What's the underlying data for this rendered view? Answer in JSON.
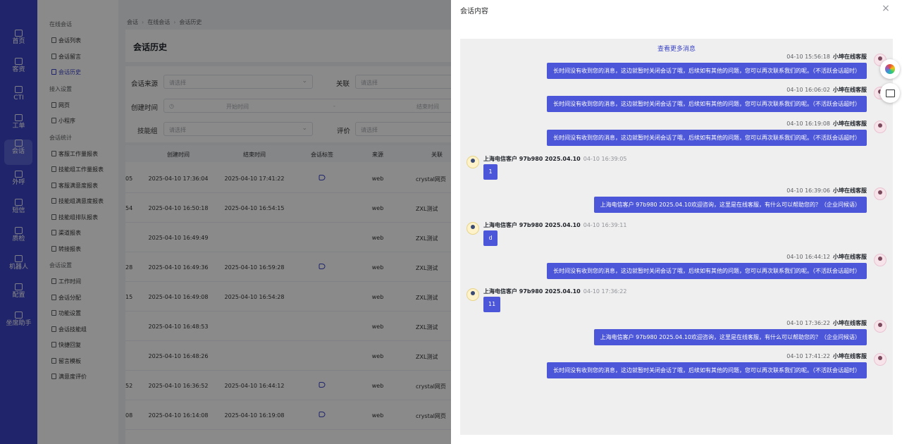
{
  "nav": {
    "items": [
      {
        "label": "首页",
        "icon": "home-icon"
      },
      {
        "label": "客资",
        "icon": "user-icon"
      },
      {
        "label": "CTI",
        "icon": "cti-icon"
      },
      {
        "label": "工单",
        "icon": "ticket-icon"
      },
      {
        "label": "会话",
        "icon": "chat-icon",
        "active": true
      },
      {
        "label": "外呼",
        "icon": "phone-icon"
      },
      {
        "label": "短信",
        "icon": "sms-icon"
      },
      {
        "label": "质检",
        "icon": "qc-icon"
      },
      {
        "label": "机器人",
        "icon": "robot-icon"
      },
      {
        "label": "配置",
        "icon": "settings-icon"
      },
      {
        "label": "坐席助手",
        "icon": "assistant-icon"
      }
    ]
  },
  "submenu": {
    "groups": [
      {
        "title": "在线会话",
        "items": [
          "会话列表",
          "会话留言",
          "会话历史"
        ]
      },
      {
        "title": "接入设置",
        "items": [
          "网页",
          "小程序"
        ]
      },
      {
        "title": "会话统计",
        "items": [
          "客服工作量报表",
          "技能组工作量报表",
          "客服满意度报表",
          "技能组满意度报表",
          "技能组排队报表",
          "渠道报表",
          "转接报表"
        ]
      },
      {
        "title": "会话设置",
        "items": [
          "工作时间",
          "会话分配",
          "功能设置",
          "会话技能组",
          "快捷回复",
          "留言模板",
          "满意度评价"
        ]
      }
    ],
    "active": "会话历史"
  },
  "breadcrumb": [
    "会话",
    "在线会话",
    "会话历史"
  ],
  "page_title": "会话历史",
  "filters": {
    "source_label": "会话来源",
    "source_placeholder": "请选择",
    "related_label": "关联",
    "related_placeholder": "请选择",
    "created_label": "创建时间",
    "start_placeholder": "开始时间",
    "range_sep": "-",
    "end_placeholder": "结束时间",
    "skill_label": "技能组",
    "skill_placeholder": "请选择",
    "rating_label": "评价",
    "rating_placeholder": "请选择"
  },
  "table": {
    "headers": [
      "创建时间",
      "结束时间",
      "会话标签",
      "来源",
      "关联"
    ],
    "rows": [
      {
        "id": "05",
        "created": "2025-04-10 17:36:04",
        "ended": "2025-04-10 17:41:22",
        "tag": true,
        "source": "web",
        "related": "crystal网页"
      },
      {
        "id": "54",
        "created": "2025-04-10 16:50:18",
        "ended": "2025-04-10 16:54:15",
        "tag": false,
        "source": "web",
        "related": "ZXL测试"
      },
      {
        "id": "",
        "created": "2025-04-10 16:49:49",
        "ended": "",
        "tag": false,
        "source": "web",
        "related": "ZXL测试"
      },
      {
        "id": "28",
        "created": "2025-04-10 16:49:36",
        "ended": "2025-04-10 16:59:28",
        "tag": true,
        "source": "web",
        "related": "ZXL测试"
      },
      {
        "id": "15",
        "created": "2025-04-10 16:49:08",
        "ended": "2025-04-10 16:54:28",
        "tag": false,
        "source": "web",
        "related": "ZXL测试"
      },
      {
        "id": "",
        "created": "2025-04-10 16:48:53",
        "ended": "",
        "tag": false,
        "source": "web",
        "related": "ZXL测试"
      },
      {
        "id": "",
        "created": "2025-04-10 16:48:26",
        "ended": "",
        "tag": false,
        "source": "web",
        "related": "ZXL测试"
      },
      {
        "id": "52",
        "created": "2025-04-10 16:36:52",
        "ended": "2025-04-10 16:44:12",
        "tag": true,
        "source": "web",
        "related": "crystal网页"
      },
      {
        "id": "08",
        "created": "2025-04-10 16:14:08",
        "ended": "2025-04-10 16:19:08",
        "tag": true,
        "source": "web",
        "related": "crystal网页"
      }
    ]
  },
  "drawer": {
    "title": "会话内容",
    "load_more": "查看更多消息",
    "messages": [
      {
        "side": "agent",
        "time": "04-10 15:56:18",
        "sender": "小坤在线客服",
        "text": "长时间没有收到您的消息，这边就暂时关闭会话了哦，后续如有其他的问题，您可以再次联系我们的呢。（不活跃会话超时）"
      },
      {
        "side": "agent",
        "time": "04-10 16:06:02",
        "sender": "小坤在线客服",
        "text": "长时间没有收到您的消息，这边就暂时关闭会话了哦，后续如有其他的问题，您可以再次联系我们的呢。（不活跃会话超时）"
      },
      {
        "side": "agent",
        "time": "04-10 16:19:08",
        "sender": "小坤在线客服",
        "text": "长时间没有收到您的消息，这边就暂时关闭会话了哦，后续如有其他的问题，您可以再次联系我们的呢。（不活跃会话超时）"
      },
      {
        "side": "customer",
        "time": "04-10 16:39:05",
        "sender": "上海电信客户 97b980 2025.04.10",
        "text": "1"
      },
      {
        "side": "agent",
        "time": "04-10 16:39:06",
        "sender": "小坤在线客服",
        "text": "上海电信客户 97b980 2025.04.10欢迎咨询，这里是在线客服，有什么可以帮助您的？（企业问候语）"
      },
      {
        "side": "customer",
        "time": "04-10 16:39:11",
        "sender": "上海电信客户 97b980 2025.04.10",
        "text": "d"
      },
      {
        "side": "agent",
        "time": "04-10 16:44:12",
        "sender": "小坤在线客服",
        "text": "长时间没有收到您的消息，这边就暂时关闭会话了哦，后续如有其他的问题，您可以再次联系我们的呢。（不活跃会话超时）"
      },
      {
        "side": "customer",
        "time": "04-10 17:36:22",
        "sender": "上海电信客户 97b980 2025.04.10",
        "text": "11"
      },
      {
        "side": "agent",
        "time": "04-10 17:36:22",
        "sender": "小坤在线客服",
        "text": "上海电信客户 97b980 2025.04.10欢迎咨询，这里是在线客服，有什么可以帮助您的？（企业问候语）"
      },
      {
        "side": "agent",
        "time": "04-10 17:41:22",
        "sender": "小坤在线客服",
        "text": "长时间没有收到您的消息，这边就暂时关闭会话了哦，后续如有其他的问题，您可以再次联系我们的呢。（不活跃会话超时）"
      }
    ]
  },
  "floating": [
    "palette-icon",
    "book-icon"
  ]
}
